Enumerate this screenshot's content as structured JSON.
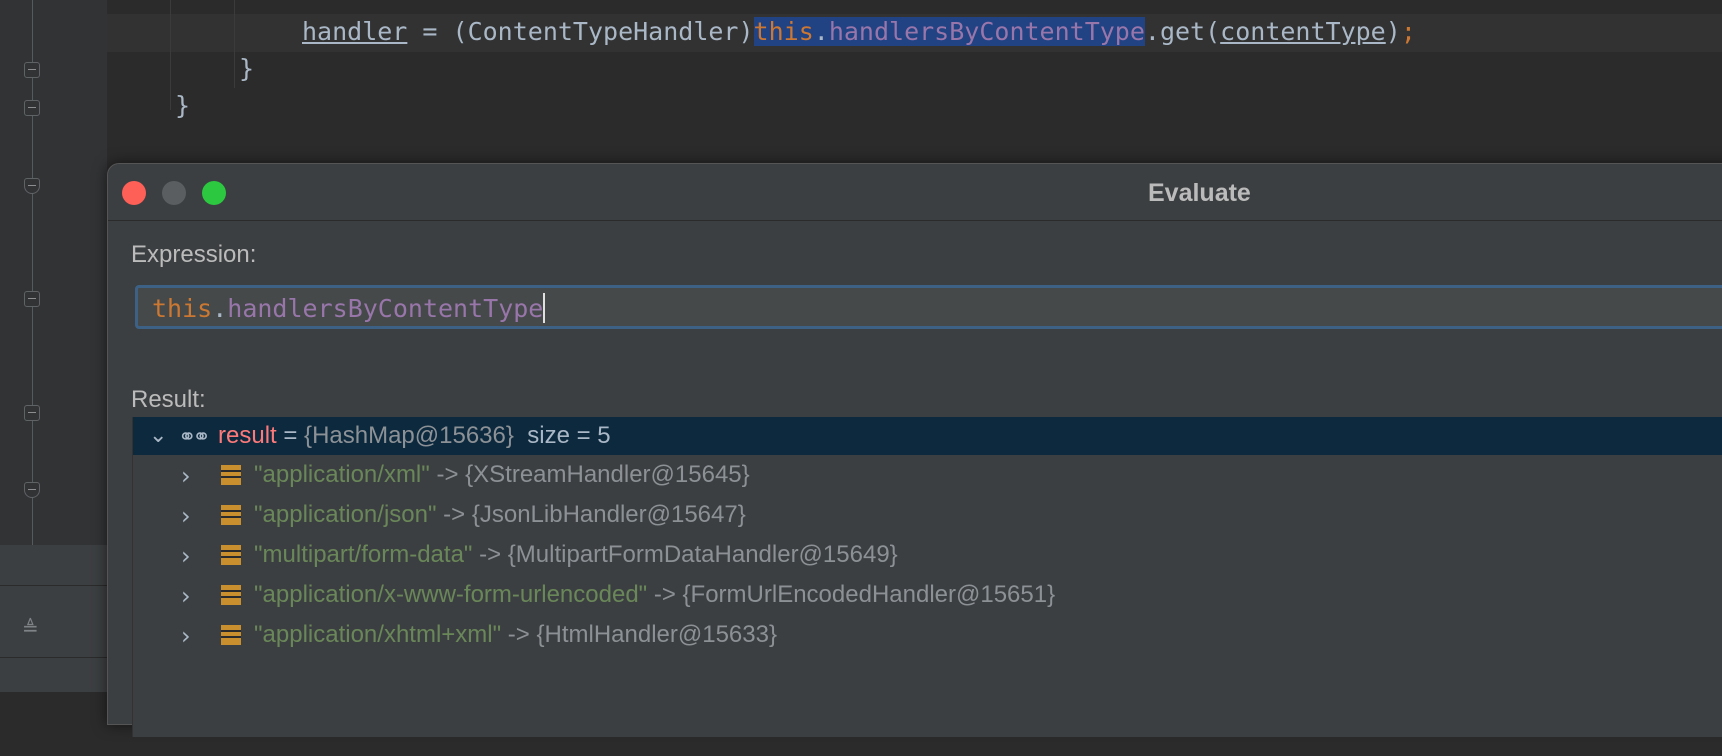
{
  "editor": {
    "line1": {
      "handler": "handler",
      "assign": " = (ContentTypeHandler)",
      "this": "this",
      "dot": ".",
      "field": "handlersByContentType",
      "get": ".get(",
      "arg": "contentType",
      "close": ")",
      "semi": ";"
    },
    "line2": "}",
    "line3": "}"
  },
  "dialog": {
    "title": "Evaluate",
    "expression_label": "Expression:",
    "expression": {
      "this": "this",
      "dot": ".",
      "field": "handlersByContentType"
    },
    "result_label": "Result:",
    "result": {
      "name": "result",
      "eq": " = ",
      "type": "{HashMap@15636}",
      "size": "size = 5",
      "entries": [
        {
          "key": "\"application/xml\"",
          "arrow": " -> ",
          "value": "{XStreamHandler@15645}"
        },
        {
          "key": "\"application/json\"",
          "arrow": " -> ",
          "value": "{JsonLibHandler@15647}"
        },
        {
          "key": "\"multipart/form-data\"",
          "arrow": " -> ",
          "value": "{MultipartFormDataHandler@15649}"
        },
        {
          "key": "\"application/x-www-form-urlencoded\"",
          "arrow": " -> ",
          "value": "{FormUrlEncodedHandler@15651}"
        },
        {
          "key": "\"application/xhtml+xml\"",
          "arrow": " -> ",
          "value": "{HtmlHandler@15633}"
        }
      ]
    }
  },
  "icons": {
    "expand": "chevron-down-icon",
    "collapse": "chevron-right-icon",
    "watch": "glasses-icon",
    "entry": "map-entry-icon"
  }
}
